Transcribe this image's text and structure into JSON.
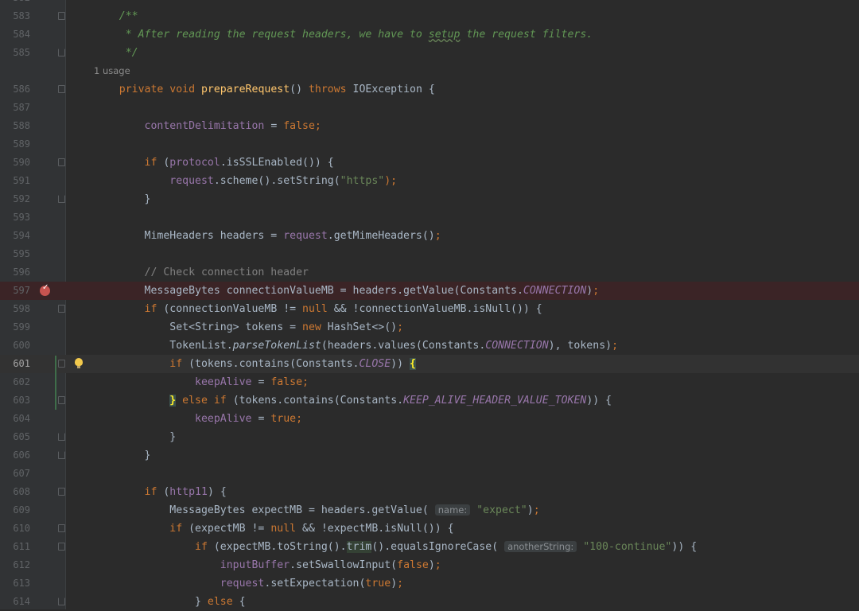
{
  "editor": {
    "top_line_number": "582",
    "usage_hint": {
      "line_after": "585",
      "text": "1 usage"
    },
    "breakpoint_line": "597",
    "current_line": "601",
    "lines": [
      {
        "n": "583",
        "tokens": [
          {
            "t": "    /**",
            "c": "doc"
          }
        ]
      },
      {
        "n": "584",
        "tokens": [
          {
            "t": "     * After reading the request headers, we have to ",
            "c": "doc"
          },
          {
            "t": "setup",
            "c": "doc uline"
          },
          {
            "t": " the request filters.",
            "c": "doc"
          }
        ]
      },
      {
        "n": "585",
        "tokens": [
          {
            "t": "     */",
            "c": "doc"
          }
        ]
      },
      {
        "n": "586",
        "tokens": [
          {
            "t": "    private void ",
            "c": "kw"
          },
          {
            "t": "prepareRequest",
            "c": "fn"
          },
          {
            "t": "() ",
            "c": ""
          },
          {
            "t": "throws ",
            "c": "kw"
          },
          {
            "t": "IOException {",
            "c": ""
          }
        ]
      },
      {
        "n": "587",
        "tokens": []
      },
      {
        "n": "588",
        "tokens": [
          {
            "t": "        contentDelimitation",
            "c": "fld"
          },
          {
            "t": " = ",
            "c": ""
          },
          {
            "t": "false",
            "c": "kw"
          },
          {
            "t": ";",
            "c": "kw"
          }
        ]
      },
      {
        "n": "589",
        "tokens": []
      },
      {
        "n": "590",
        "tokens": [
          {
            "t": "        if ",
            "c": "kw"
          },
          {
            "t": "(",
            "c": ""
          },
          {
            "t": "protocol",
            "c": "fld"
          },
          {
            "t": ".isSSLEnabled()) {",
            "c": ""
          }
        ]
      },
      {
        "n": "591",
        "tokens": [
          {
            "t": "            request",
            "c": "fld"
          },
          {
            "t": ".scheme().setString(",
            "c": ""
          },
          {
            "t": "\"https\"",
            "c": "str"
          },
          {
            "t": ");",
            "c": "kw"
          }
        ]
      },
      {
        "n": "592",
        "tokens": [
          {
            "t": "        }",
            "c": ""
          }
        ]
      },
      {
        "n": "593",
        "tokens": []
      },
      {
        "n": "594",
        "tokens": [
          {
            "t": "        MimeHeaders headers = ",
            "c": ""
          },
          {
            "t": "request",
            "c": "fld"
          },
          {
            "t": ".getMimeHeaders()",
            "c": ""
          },
          {
            "t": ";",
            "c": "kw"
          }
        ]
      },
      {
        "n": "595",
        "tokens": []
      },
      {
        "n": "596",
        "tokens": [
          {
            "t": "        // Check connection header",
            "c": "cmt"
          }
        ]
      },
      {
        "n": "597",
        "tokens": [
          {
            "t": "        MessageBytes connectionValueMB = headers.getValue(Constants.",
            "c": ""
          },
          {
            "t": "CONNECTION",
            "c": "cst"
          },
          {
            "t": ")",
            "c": ""
          },
          {
            "t": ";",
            "c": "kw"
          }
        ]
      },
      {
        "n": "598",
        "tokens": [
          {
            "t": "        if ",
            "c": "kw"
          },
          {
            "t": "(connectionValueMB != ",
            "c": ""
          },
          {
            "t": "null",
            "c": "kw"
          },
          {
            "t": " && !connectionValueMB.isNull()) {",
            "c": ""
          }
        ]
      },
      {
        "n": "599",
        "tokens": [
          {
            "t": "            Set<String> tokens = ",
            "c": ""
          },
          {
            "t": "new ",
            "c": "kw"
          },
          {
            "t": "HashSet<>()",
            "c": ""
          },
          {
            "t": ";",
            "c": "kw"
          }
        ]
      },
      {
        "n": "600",
        "tokens": [
          {
            "t": "            TokenList.",
            "c": ""
          },
          {
            "t": "parseTokenList",
            "c": "it"
          },
          {
            "t": "(headers.values(Constants.",
            "c": ""
          },
          {
            "t": "CONNECTION",
            "c": "cst"
          },
          {
            "t": "), tokens)",
            "c": ""
          },
          {
            "t": ";",
            "c": "kw"
          }
        ]
      },
      {
        "n": "601",
        "tokens": [
          {
            "t": "            if ",
            "c": "kw"
          },
          {
            "t": "(tokens.contains(Constants.",
            "c": ""
          },
          {
            "t": "CLOSE",
            "c": "cst"
          },
          {
            "t": ")) ",
            "c": ""
          },
          {
            "t": "{",
            "c": "brace-hl"
          }
        ]
      },
      {
        "n": "602",
        "tokens": [
          {
            "t": "                keepAlive",
            "c": "fld"
          },
          {
            "t": " = ",
            "c": ""
          },
          {
            "t": "false",
            "c": "kw"
          },
          {
            "t": ";",
            "c": "kw"
          }
        ]
      },
      {
        "n": "603",
        "tokens": [
          {
            "t": "            ",
            "c": ""
          },
          {
            "t": "}",
            "c": "brace-hl"
          },
          {
            "t": " else if ",
            "c": "kw"
          },
          {
            "t": "(tokens.contains(Constants.",
            "c": ""
          },
          {
            "t": "KEEP_ALIVE_HEADER_VALUE_TOKEN",
            "c": "cst"
          },
          {
            "t": ")) {",
            "c": ""
          }
        ]
      },
      {
        "n": "604",
        "tokens": [
          {
            "t": "                keepAlive",
            "c": "fld"
          },
          {
            "t": " = ",
            "c": ""
          },
          {
            "t": "true",
            "c": "kw"
          },
          {
            "t": ";",
            "c": "kw"
          }
        ]
      },
      {
        "n": "605",
        "tokens": [
          {
            "t": "            }",
            "c": ""
          }
        ]
      },
      {
        "n": "606",
        "tokens": [
          {
            "t": "        }",
            "c": ""
          }
        ]
      },
      {
        "n": "607",
        "tokens": []
      },
      {
        "n": "608",
        "tokens": [
          {
            "t": "        if ",
            "c": "kw"
          },
          {
            "t": "(",
            "c": ""
          },
          {
            "t": "http11",
            "c": "fld"
          },
          {
            "t": ") {",
            "c": ""
          }
        ]
      },
      {
        "n": "609",
        "tokens": [
          {
            "t": "            MessageBytes expectMB = headers.getValue( ",
            "c": ""
          },
          {
            "t": "name:",
            "c": "hint"
          },
          {
            "t": " ",
            "c": ""
          },
          {
            "t": "\"expect\"",
            "c": "str"
          },
          {
            "t": ")",
            "c": ""
          },
          {
            "t": ";",
            "c": "kw"
          }
        ]
      },
      {
        "n": "610",
        "tokens": [
          {
            "t": "            if ",
            "c": "kw"
          },
          {
            "t": "(expectMB != ",
            "c": ""
          },
          {
            "t": "null",
            "c": "kw"
          },
          {
            "t": " && !expectMB.isNull()) {",
            "c": ""
          }
        ]
      },
      {
        "n": "611",
        "tokens": [
          {
            "t": "                if ",
            "c": "kw"
          },
          {
            "t": "(expectMB.toString().",
            "c": ""
          },
          {
            "t": "trim",
            "c": "word-hl"
          },
          {
            "t": "().equalsIgnoreCase( ",
            "c": ""
          },
          {
            "t": "anotherString:",
            "c": "hint"
          },
          {
            "t": " ",
            "c": ""
          },
          {
            "t": "\"100-continue\"",
            "c": "str"
          },
          {
            "t": ")) {",
            "c": ""
          }
        ]
      },
      {
        "n": "612",
        "tokens": [
          {
            "t": "                    inputBuffer",
            "c": "fld"
          },
          {
            "t": ".setSwallowInput(",
            "c": ""
          },
          {
            "t": "false",
            "c": "kw"
          },
          {
            "t": ")",
            "c": ""
          },
          {
            "t": ";",
            "c": "kw"
          }
        ]
      },
      {
        "n": "613",
        "tokens": [
          {
            "t": "                    request",
            "c": "fld"
          },
          {
            "t": ".setExpectation(",
            "c": ""
          },
          {
            "t": "true",
            "c": "kw"
          },
          {
            "t": ")",
            "c": ""
          },
          {
            "t": ";",
            "c": "kw"
          }
        ]
      },
      {
        "n": "614",
        "tokens": [
          {
            "t": "                } ",
            "c": ""
          },
          {
            "t": "else ",
            "c": "kw"
          },
          {
            "t": "{",
            "c": ""
          }
        ]
      }
    ]
  }
}
